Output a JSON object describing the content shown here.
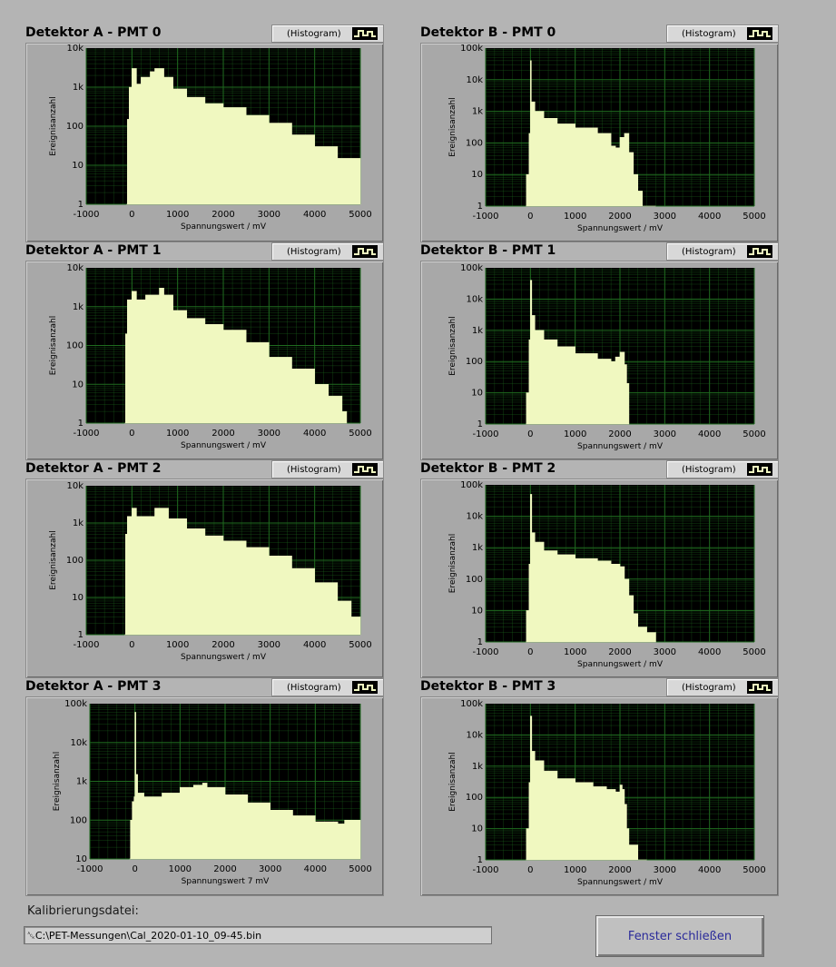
{
  "panels": [
    {
      "title": "Detektor A - PMT 0",
      "legend": "(Histogram)",
      "xlabel": "Spannungswert / mV",
      "ylabel": "Ereignisanzahl"
    },
    {
      "title": "Detektor B - PMT 0",
      "legend": "(Histogram)",
      "xlabel": "Spannungswert / mV",
      "ylabel": "Ereignisanzahl"
    },
    {
      "title": "Detektor A - PMT 1",
      "legend": "(Histogram)",
      "xlabel": "Spannungswert / mV",
      "ylabel": "Ereignisanzahl"
    },
    {
      "title": "Detektor B - PMT 1",
      "legend": "(Histogram)",
      "xlabel": "Spannungswert / mV",
      "ylabel": "Ereignisanzahl"
    },
    {
      "title": "Detektor A - PMT 2",
      "legend": "(Histogram)",
      "xlabel": "Spannungswert / mV",
      "ylabel": "Ereignisanzahl"
    },
    {
      "title": "Detektor B - PMT 2",
      "legend": "(Histogram)",
      "xlabel": "Spannungswert / mV",
      "ylabel": "Ereignisanzahl"
    },
    {
      "title": "Detektor A - PMT 3",
      "legend": "(Histogram)",
      "xlabel": "Spannungswert 7 mV",
      "ylabel": "Ereignisanzahl"
    },
    {
      "title": "Detektor B - PMT 3",
      "legend": "(Histogram)",
      "xlabel": "Spannungswert / mV",
      "ylabel": "Ereignisanzahl"
    }
  ],
  "calibration": {
    "label": "Kalibrierungsdatei:",
    "path": "C:\\PET-Messungen\\Cal_2020-01-10_09-45.bin"
  },
  "close_button": "Fenster schließen",
  "colors": {
    "background": "#b4b4b4",
    "plot_bg": "#000000",
    "grid": "#1f6b1f",
    "fill": "#f0f8c0"
  },
  "chart_data": [
    {
      "type": "area",
      "title": "Detektor A - PMT 0",
      "xlabel": "Spannungswert / mV",
      "ylabel": "Ereignisanzahl",
      "xlim": [
        -1000,
        5000
      ],
      "ylim": [
        1,
        10000
      ],
      "ylog": true,
      "grid": true,
      "xticks": [
        "-1000",
        "0",
        "1000",
        "2000",
        "3000",
        "4000",
        "5000"
      ],
      "yticks": [
        "1",
        "10",
        "100",
        "1k",
        "10k"
      ],
      "x": [
        -120,
        -100,
        -60,
        0,
        100,
        200,
        400,
        500,
        700,
        900,
        1200,
        1600,
        2000,
        2500,
        3000,
        3500,
        4000,
        4500,
        5000
      ],
      "y": [
        1,
        150,
        1000,
        3000,
        1200,
        1800,
        2500,
        3000,
        1800,
        900,
        550,
        380,
        300,
        190,
        120,
        60,
        30,
        15,
        8
      ]
    },
    {
      "type": "area",
      "title": "Detektor B - PMT 0",
      "xlabel": "Spannungswert / mV",
      "ylabel": "Ereignisanzahl",
      "xlim": [
        -1000,
        5000
      ],
      "ylim": [
        1,
        100000
      ],
      "ylog": true,
      "grid": true,
      "xticks": [
        "-1000",
        "0",
        "1000",
        "2000",
        "3000",
        "4000",
        "5000"
      ],
      "yticks": [
        "1",
        "10",
        "100",
        "1k",
        "10k",
        "100k"
      ],
      "x": [
        -100,
        -90,
        -30,
        0,
        20,
        100,
        300,
        600,
        1000,
        1500,
        1800,
        1900,
        2000,
        2100,
        2200,
        2300,
        2400,
        2500,
        2800
      ],
      "y": [
        1,
        10,
        200,
        40000,
        2000,
        1000,
        600,
        400,
        300,
        200,
        80,
        70,
        150,
        200,
        50,
        10,
        3,
        1,
        1
      ]
    },
    {
      "type": "area",
      "title": "Detektor A - PMT 1",
      "xlabel": "Spannungswert / mV",
      "ylabel": "Ereignisanzahl",
      "xlim": [
        -1000,
        5000
      ],
      "ylim": [
        1,
        10000
      ],
      "ylog": true,
      "grid": true,
      "xticks": [
        "-1000",
        "0",
        "1000",
        "2000",
        "3000",
        "4000",
        "5000"
      ],
      "yticks": [
        "1",
        "10",
        "100",
        "1k",
        "10k"
      ],
      "x": [
        -160,
        -140,
        -100,
        0,
        100,
        300,
        600,
        700,
        900,
        1200,
        1600,
        2000,
        2500,
        3000,
        3500,
        4000,
        4300,
        4600,
        4700
      ],
      "y": [
        1,
        200,
        1500,
        2500,
        1500,
        2000,
        3000,
        2000,
        800,
        500,
        350,
        250,
        120,
        50,
        25,
        10,
        5,
        2,
        1
      ]
    },
    {
      "type": "area",
      "title": "Detektor B - PMT 1",
      "xlabel": "Spannungswert / mV",
      "ylabel": "Ereignisanzahl",
      "xlim": [
        -1000,
        5000
      ],
      "ylim": [
        1,
        100000
      ],
      "ylog": true,
      "grid": true,
      "xticks": [
        "-1000",
        "0",
        "1000",
        "2000",
        "3000",
        "4000",
        "5000"
      ],
      "yticks": [
        "1",
        "10",
        "100",
        "1k",
        "10k",
        "100k"
      ],
      "x": [
        -100,
        -90,
        -30,
        0,
        30,
        100,
        300,
        600,
        1000,
        1500,
        1800,
        1900,
        2000,
        2100,
        2150,
        2200
      ],
      "y": [
        1,
        10,
        500,
        40000,
        3000,
        1000,
        500,
        300,
        180,
        120,
        100,
        140,
        200,
        80,
        20,
        1
      ]
    },
    {
      "type": "area",
      "title": "Detektor A - PMT 2",
      "xlabel": "Spannungswert / mV",
      "ylabel": "Ereignisanzahl",
      "xlim": [
        -1000,
        5000
      ],
      "ylim": [
        1,
        10000
      ],
      "ylog": true,
      "grid": true,
      "xticks": [
        "-1000",
        "0",
        "1000",
        "2000",
        "3000",
        "4000",
        "5000"
      ],
      "yticks": [
        "1",
        "10",
        "100",
        "1k",
        "10k"
      ],
      "x": [
        -160,
        -140,
        -100,
        0,
        100,
        300,
        500,
        800,
        1200,
        1600,
        2000,
        2500,
        3000,
        3500,
        4000,
        4500,
        4800,
        5000
      ],
      "y": [
        1,
        500,
        1500,
        2500,
        1500,
        1500,
        2500,
        1300,
        700,
        450,
        330,
        220,
        130,
        60,
        25,
        8,
        3,
        1
      ]
    },
    {
      "type": "area",
      "title": "Detektor B - PMT 2",
      "xlabel": "Spannungswert / mV",
      "ylabel": "Ereignisanzahl",
      "xlim": [
        -1000,
        5000
      ],
      "ylim": [
        1,
        100000
      ],
      "ylog": true,
      "grid": true,
      "xticks": [
        "-1000",
        "0",
        "1000",
        "2000",
        "3000",
        "4000",
        "5000"
      ],
      "yticks": [
        "1",
        "10",
        "100",
        "1k",
        "10k",
        "100k"
      ],
      "x": [
        -100,
        -90,
        -30,
        0,
        30,
        100,
        300,
        600,
        1000,
        1500,
        1800,
        2000,
        2100,
        2200,
        2300,
        2400,
        2600,
        2800
      ],
      "y": [
        1,
        10,
        300,
        50000,
        3000,
        1500,
        800,
        600,
        450,
        380,
        300,
        250,
        100,
        30,
        8,
        3,
        2,
        1
      ]
    },
    {
      "type": "area",
      "title": "Detektor A - PMT 3",
      "xlabel": "Spannungswert 7 mV",
      "ylabel": "Ereignisanzahl",
      "xlim": [
        -1000,
        5000
      ],
      "ylim": [
        10,
        100000
      ],
      "ylog": true,
      "grid": true,
      "xticks": [
        "-1000",
        "0",
        "1000",
        "2000",
        "3000",
        "4000",
        "5000"
      ],
      "yticks": [
        "10",
        "100",
        "1k",
        "10k",
        "100k"
      ],
      "x": [
        -120,
        -100,
        -60,
        -20,
        0,
        20,
        60,
        200,
        600,
        1000,
        1300,
        1500,
        1600,
        2000,
        2500,
        3000,
        3500,
        4000,
        4500,
        4650,
        5000
      ],
      "y": [
        10,
        100,
        300,
        400,
        60000,
        1500,
        500,
        400,
        500,
        700,
        800,
        900,
        700,
        450,
        280,
        180,
        130,
        90,
        80,
        100,
        60
      ]
    },
    {
      "type": "area",
      "title": "Detektor B - PMT 3",
      "xlabel": "Spannungswert / mV",
      "ylabel": "Ereignisanzahl",
      "xlim": [
        -1000,
        5000
      ],
      "ylim": [
        1,
        100000
      ],
      "ylog": true,
      "grid": true,
      "xticks": [
        "-1000",
        "0",
        "1000",
        "2000",
        "3000",
        "4000",
        "5000"
      ],
      "yticks": [
        "1",
        "10",
        "100",
        "1k",
        "10k",
        "100k"
      ],
      "x": [
        -100,
        -90,
        -30,
        0,
        30,
        100,
        300,
        600,
        1000,
        1400,
        1700,
        1900,
        2000,
        2050,
        2100,
        2150,
        2200,
        2400,
        2600
      ],
      "y": [
        1,
        10,
        300,
        40000,
        3000,
        1500,
        700,
        400,
        300,
        220,
        180,
        150,
        250,
        180,
        60,
        10,
        3,
        1,
        1
      ]
    }
  ]
}
